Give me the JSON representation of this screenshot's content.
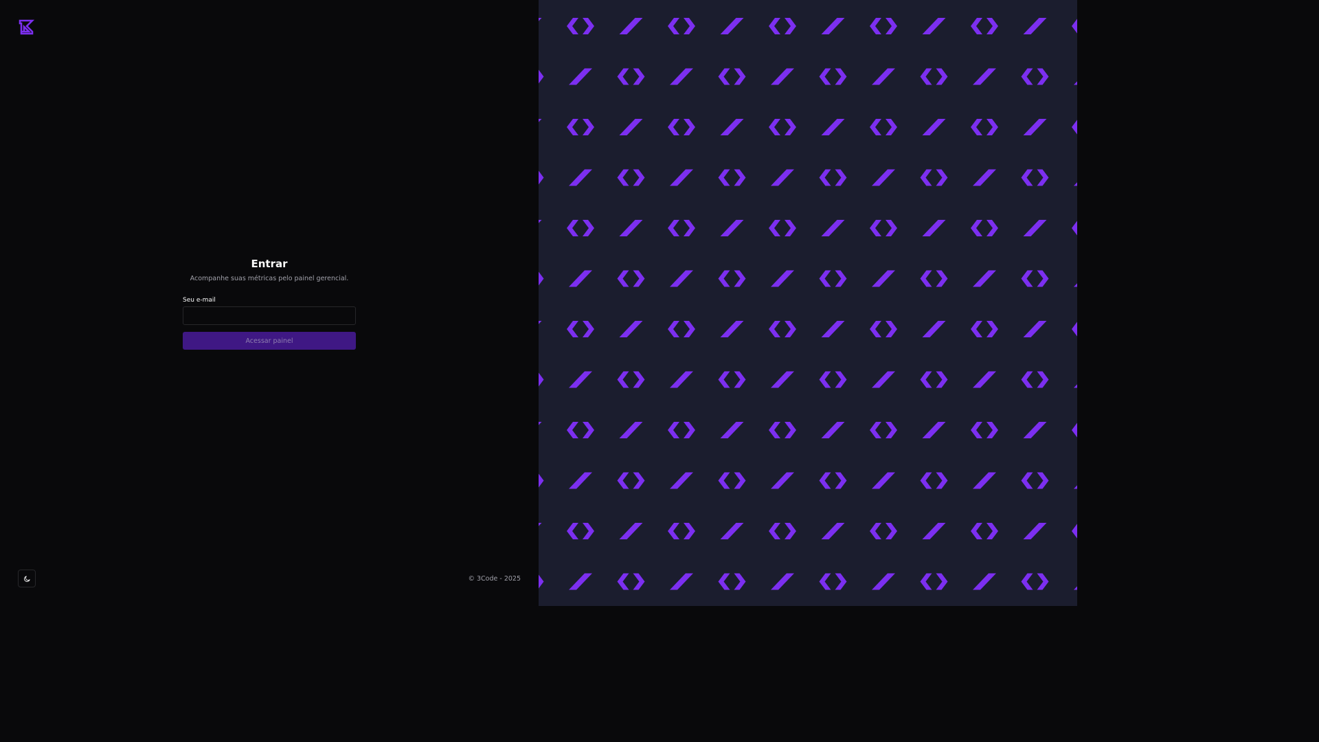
{
  "brand": {
    "logo_icon": "brand-logo-icon",
    "accent": "#7c2ff0"
  },
  "login": {
    "title": "Entrar",
    "subtitle": "Acompanhe suas métricas pelo painel gerencial.",
    "email_label": "Seu e-mail",
    "email_value": "",
    "email_placeholder": "",
    "submit_label": "Acessar painel"
  },
  "footer": {
    "theme_toggle_icon": "moon-icon",
    "copyright": "© 3Code - 2025"
  },
  "decoration": {
    "pattern_icons": [
      "code-brackets-icon",
      "slash-icon"
    ],
    "pattern_color": "#7c2ff0",
    "panel_color": "#1b1d2e"
  }
}
